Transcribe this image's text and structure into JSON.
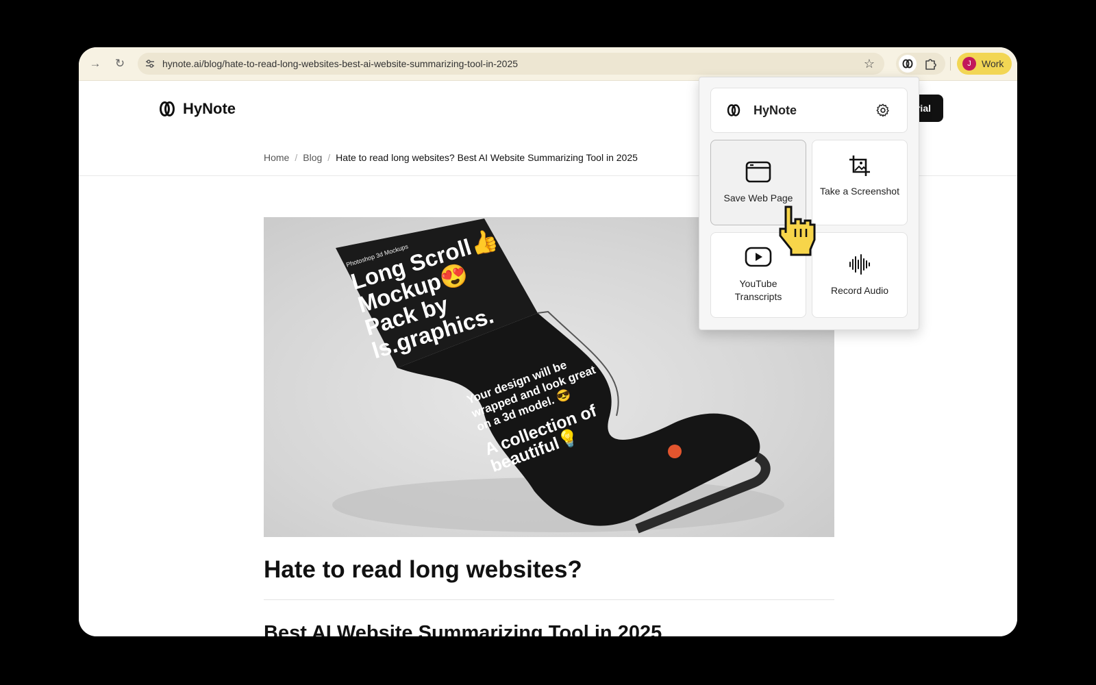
{
  "browser": {
    "url": "hynote.ai/blog/hate-to-read-long-websites-best-ai-website-summarizing-tool-in-2025",
    "profile_initial": "J",
    "profile_label": "Work"
  },
  "site": {
    "logo_text": "HyNote",
    "trial_button_text": "rial",
    "breadcrumb": {
      "home": "Home",
      "sep1": "/",
      "blog": "Blog",
      "sep2": "/",
      "current": "Hate to read long websites? Best AI Website Summarizing Tool in 2025"
    }
  },
  "hero": {
    "lines": [
      "Long Scroll👍",
      "Mockup😍",
      "Pack by",
      "ls.graphics."
    ],
    "tag": "Photoshop 3d Mockups",
    "paper_a": "Your design will be",
    "paper_b": "wrapped and look great",
    "paper_c": "on a 3d model. 😎",
    "paper_d": "A collection of",
    "paper_e": "beautiful💡"
  },
  "article": {
    "title": "Hate to read long websites?",
    "subtitle": "Best AI Website Summarizing Tool in 2025"
  },
  "popup": {
    "title": "HyNote",
    "tiles": [
      {
        "label": "Save Web Page",
        "icon": "browser-window-icon"
      },
      {
        "label": "Take a Screenshot",
        "icon": "crop-image-icon"
      },
      {
        "label": "YouTube Transcripts",
        "icon": "youtube-play-icon"
      },
      {
        "label": "Record Audio",
        "icon": "waveform-icon"
      }
    ]
  },
  "colors": {
    "toolbar": "#f7f2e3",
    "profile_pill": "#f2d654",
    "avatar": "#c2185b",
    "accent_dark": "#111111"
  }
}
